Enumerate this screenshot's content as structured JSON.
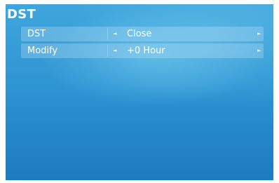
{
  "page": {
    "title": "DST"
  },
  "settings": [
    {
      "label": "DST",
      "value": "Close"
    },
    {
      "label": "Modify",
      "value": "+0 Hour"
    }
  ],
  "icons": {
    "left": "◄",
    "right": "►"
  },
  "colors": {
    "background_top": "#3fa5dc",
    "background_bottom": "#1d7bbf",
    "row_fill": "#d2ebfa"
  }
}
